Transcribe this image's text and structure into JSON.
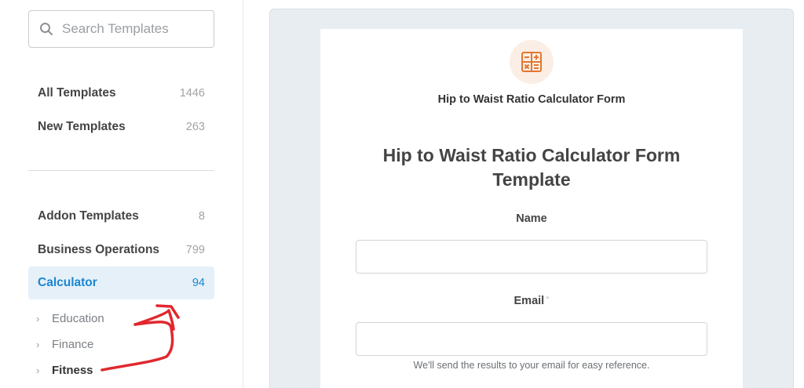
{
  "search": {
    "placeholder": "Search Templates",
    "icon": "search-icon"
  },
  "sidebar": {
    "categories_top": [
      {
        "label": "All Templates",
        "count": "1446"
      },
      {
        "label": "New Templates",
        "count": "263"
      }
    ],
    "categories": [
      {
        "label": "Addon Templates",
        "count": "8"
      },
      {
        "label": "Business Operations",
        "count": "799"
      },
      {
        "label": "Calculator",
        "count": "94",
        "active": true
      }
    ],
    "subcategories": [
      {
        "label": "Education"
      },
      {
        "label": "Finance"
      },
      {
        "label": "Fitness",
        "bold": true
      }
    ]
  },
  "preview": {
    "form_name": "Hip to Waist Ratio Calculator Form",
    "title": "Hip to Waist Ratio Calculator Form Template",
    "logo_icon": "calculator-icon",
    "fields": [
      {
        "label": "Name",
        "required": false
      },
      {
        "label": "Email",
        "required": true,
        "required_mark": "*",
        "help": "We'll send the results to your email for easy reference."
      }
    ]
  },
  "colors": {
    "accent": "#1a86d0",
    "active_bg": "#e6f0f9",
    "logo_bg": "#fbeee4",
    "logo_icon": "#e27730",
    "annotation": "#e0282e"
  }
}
